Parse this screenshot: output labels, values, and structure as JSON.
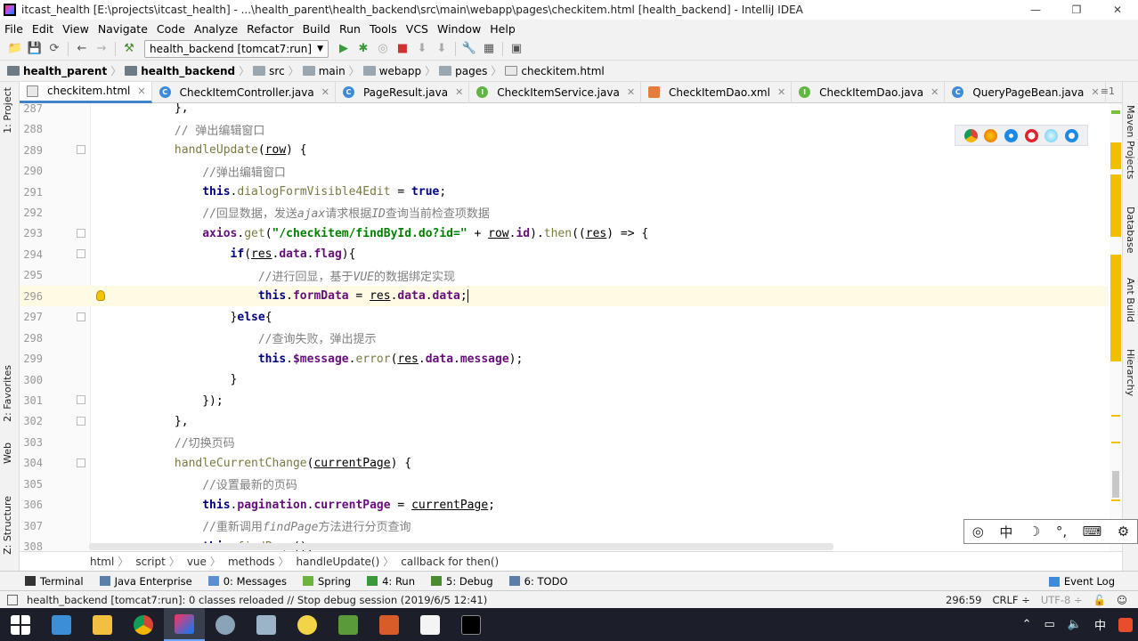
{
  "window": {
    "title": "itcast_health [E:\\projects\\itcast_health] - ...\\health_parent\\health_backend\\src\\main\\webapp\\pages\\checkitem.html [health_backend] - IntelliJ IDEA",
    "min": "—",
    "max": "❐",
    "close": "✕"
  },
  "menu": [
    "File",
    "Edit",
    "View",
    "Navigate",
    "Code",
    "Analyze",
    "Refactor",
    "Build",
    "Run",
    "Tools",
    "VCS",
    "Window",
    "Help"
  ],
  "toolbar": {
    "run_config": "health_backend [tomcat7:run]"
  },
  "breadcrumbs": [
    {
      "label": "health_parent",
      "bold": true,
      "icon": "module-folder-icon"
    },
    {
      "label": "health_backend",
      "bold": true,
      "icon": "module-folder-icon"
    },
    {
      "label": "src",
      "bold": false,
      "icon": "folder-icon"
    },
    {
      "label": "main",
      "bold": false,
      "icon": "folder-icon"
    },
    {
      "label": "webapp",
      "bold": false,
      "icon": "folder-icon"
    },
    {
      "label": "pages",
      "bold": false,
      "icon": "folder-icon"
    },
    {
      "label": "checkitem.html",
      "bold": false,
      "icon": "html-file-icon"
    }
  ],
  "tabs": [
    {
      "label": "checkitem.html",
      "type": "h",
      "active": true
    },
    {
      "label": "CheckItemController.java",
      "type": "c"
    },
    {
      "label": "PageResult.java",
      "type": "c"
    },
    {
      "label": "CheckItemService.java",
      "type": "i"
    },
    {
      "label": "CheckItemDao.xml",
      "type": "x"
    },
    {
      "label": "CheckItemDao.java",
      "type": "i"
    },
    {
      "label": "QueryPageBean.java",
      "type": "c"
    }
  ],
  "tabs_more": "≡1",
  "left_tools": [
    "1: Project",
    "2: Favorites",
    "Web",
    "Z: Structure"
  ],
  "right_tools": [
    "Maven Projects",
    "Database",
    "Ant Build",
    "Hierarchy"
  ],
  "lines": [
    {
      "n": "287",
      "html": "            },"
    },
    {
      "n": "288",
      "html": "            <span class='cm'>// 弹出编辑窗口</span>"
    },
    {
      "n": "289",
      "html": "            <span class='fn'>handleUpdate</span>(<span class='u'>row</span>) {"
    },
    {
      "n": "290",
      "html": "                <span class='cm'>//弹出编辑窗口</span>"
    },
    {
      "n": "291",
      "html": "                <span class='k'>this</span>.<span class='fn'>dialogFormVisible4Edit</span> = <span class='k'>true</span>;"
    },
    {
      "n": "292",
      "html": "                <span class='cm'>//回显数据，发送<i>ajax</i>请求根据<i>ID</i>查询当前检查项数据</span>"
    },
    {
      "n": "293",
      "html": "                <span class='pr'>axios</span>.<span class='fn'>get</span>(<span class='str'>\"/checkitem/findById.do?id=\"</span> + <span class='u'>row</span>.<span class='pr'>id</span>).<span class='fn'>then</span>((<span class='u'>res</span>) => {"
    },
    {
      "n": "294",
      "html": "                    <span class='k'>if</span>(<span class='u'>res</span>.<span class='pr'>data</span>.<span class='pr'>flag</span>){"
    },
    {
      "n": "295",
      "html": "                        <span class='cm'>//进行回显，基于<i>VUE</i>的数据绑定实现</span>"
    },
    {
      "n": "296",
      "html": "                        <span class='k'>this</span>.<span class='pr'>formData</span> = <span class='u'>res</span>.<span class='pr'>data</span>.<span class='pr'>data</span>;<span class='caret'></span>",
      "current": true
    },
    {
      "n": "297",
      "html": "                    }<span class='k'>else</span>{"
    },
    {
      "n": "298",
      "html": "                        <span class='cm'>//查询失败，弹出提示</span>"
    },
    {
      "n": "299",
      "html": "                        <span class='k'>this</span>.<span class='pr'>$message</span>.<span class='fn'>error</span>(<span class='u'>res</span>.<span class='pr'>data</span>.<span class='pr'>message</span>);"
    },
    {
      "n": "300",
      "html": "                    }"
    },
    {
      "n": "301",
      "html": "                });"
    },
    {
      "n": "302",
      "html": "            },"
    },
    {
      "n": "303",
      "html": "            <span class='cm'>//切换页码</span>"
    },
    {
      "n": "304",
      "html": "            <span class='fn'>handleCurrentChange</span>(<span class='u'>currentPage</span>) {"
    },
    {
      "n": "305",
      "html": "                <span class='cm'>//设置最新的页码</span>"
    },
    {
      "n": "306",
      "html": "                <span class='k'>this</span>.<span class='pr'>pagination</span>.<span class='pr'>currentPage</span> = <span class='u'>currentPage</span>;"
    },
    {
      "n": "307",
      "html": "                <span class='cm'>//重新调用<i>findPage</i>方法进行分页查询</span>"
    },
    {
      "n": "308",
      "html": "                <span class='k'>this</span>.<span class='fn'>findPage</span>();"
    }
  ],
  "ime": [
    "中",
    "☽",
    "°,",
    "⌨",
    "⚙"
  ],
  "path": [
    "html",
    "script",
    "vue",
    "methods",
    "handleUpdate()",
    "callback for then()"
  ],
  "toolwindows": [
    {
      "label": "Terminal",
      "icon": "terminal-icon"
    },
    {
      "label": "Java Enterprise",
      "icon": "java-enterprise-icon"
    },
    {
      "label": "0: Messages",
      "icon": "messages-icon"
    },
    {
      "label": "Spring",
      "icon": "spring-icon"
    },
    {
      "label": "4: Run",
      "icon": "run-icon"
    },
    {
      "label": "5: Debug",
      "icon": "debug-icon"
    },
    {
      "label": "6: TODO",
      "icon": "todo-icon"
    }
  ],
  "event_log": "Event Log",
  "status": {
    "message": "health_backend [tomcat7:run]: 0 classes reloaded // Stop debug session (2019/6/5 12:41)",
    "position": "296:59",
    "line_sep": "CRLF ÷",
    "encoding": "UTF-8 ÷"
  },
  "tray": {
    "ime": "中"
  }
}
